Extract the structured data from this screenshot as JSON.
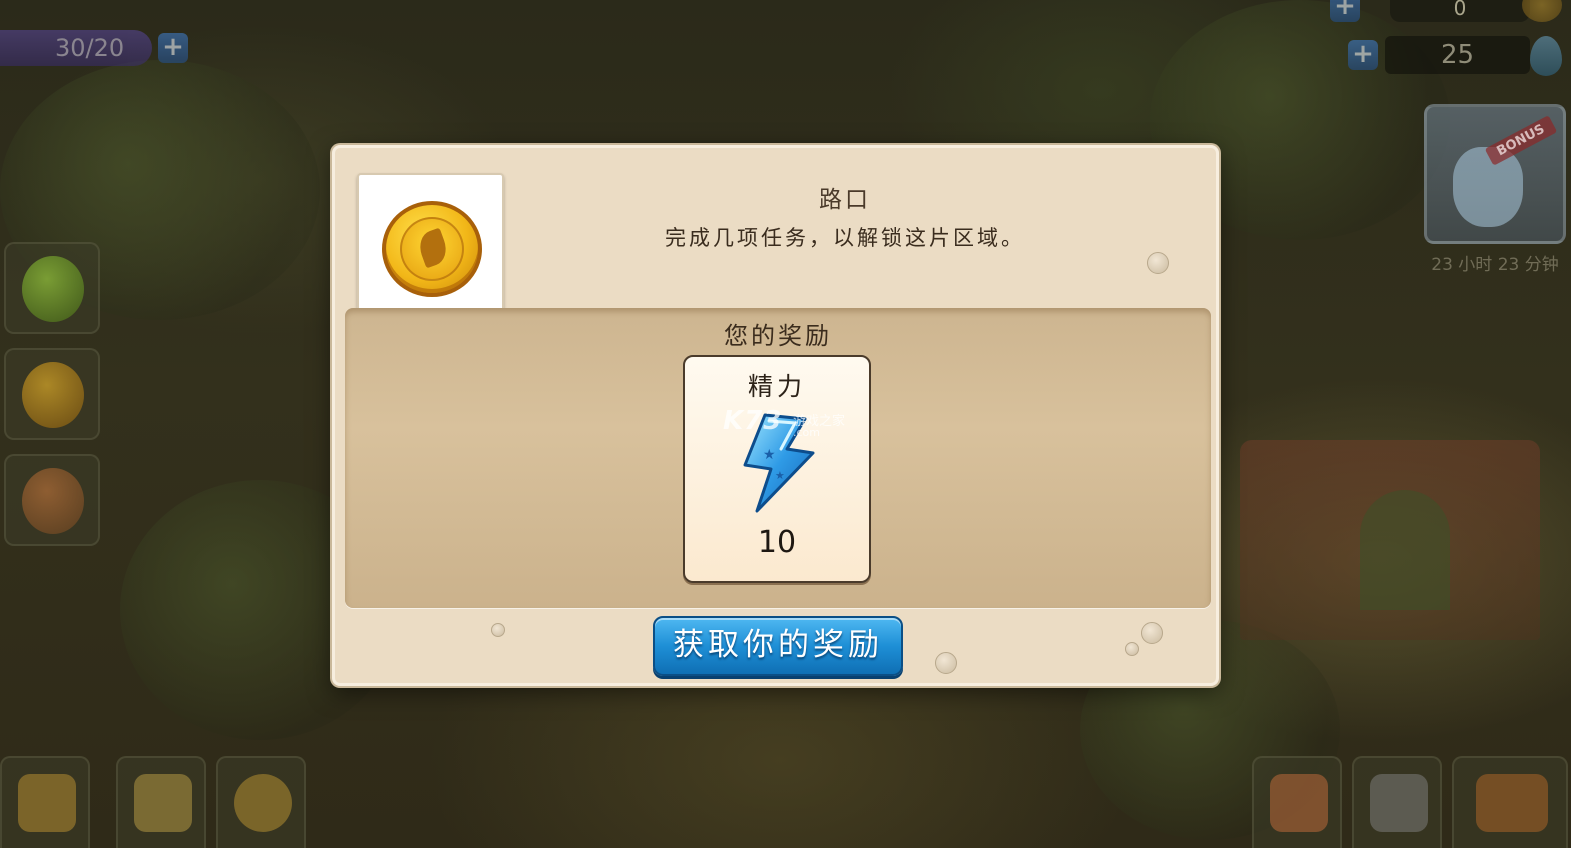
{
  "hud": {
    "energy_text": "30/20",
    "energy_plus": "+",
    "top_right_value": "0",
    "coins_value": "25",
    "coins_plus": "+",
    "top_plus": "+"
  },
  "bonus": {
    "ribbon_label": "BONUS",
    "timer_text": "23 小时 23 分钟",
    "icon": "rabbit-icon"
  },
  "side_items": [
    {
      "icon": "apple-icon"
    },
    {
      "icon": "coin-icon"
    },
    {
      "icon": "fox-icon"
    }
  ],
  "bottom_items": [
    {
      "icon": "market-stall-icon"
    },
    {
      "icon": "move-arrows-icon"
    },
    {
      "icon": "settings-gear-icon"
    },
    {
      "icon": "friends-icon"
    },
    {
      "icon": "horse-icon"
    },
    {
      "icon": "treasure-chest-icon"
    }
  ],
  "dialog": {
    "title": "路口",
    "description": "完成几项任务，以解锁这片区域。",
    "icon": "gold-medal-icon",
    "reward_section_title": "您的奖励",
    "reward": {
      "label": "精力",
      "amount": "10",
      "icon": "lightning-bolt-icon"
    },
    "claim_button_label": "获取你的奖励"
  },
  "watermark": {
    "main": "K73",
    "sub": "游戏之家",
    "domain": ".com"
  },
  "colors": {
    "dialog_bg": "#ebdcc4",
    "panel_bg": "#d8c19c",
    "button_blue": "#1e8fd6"
  }
}
